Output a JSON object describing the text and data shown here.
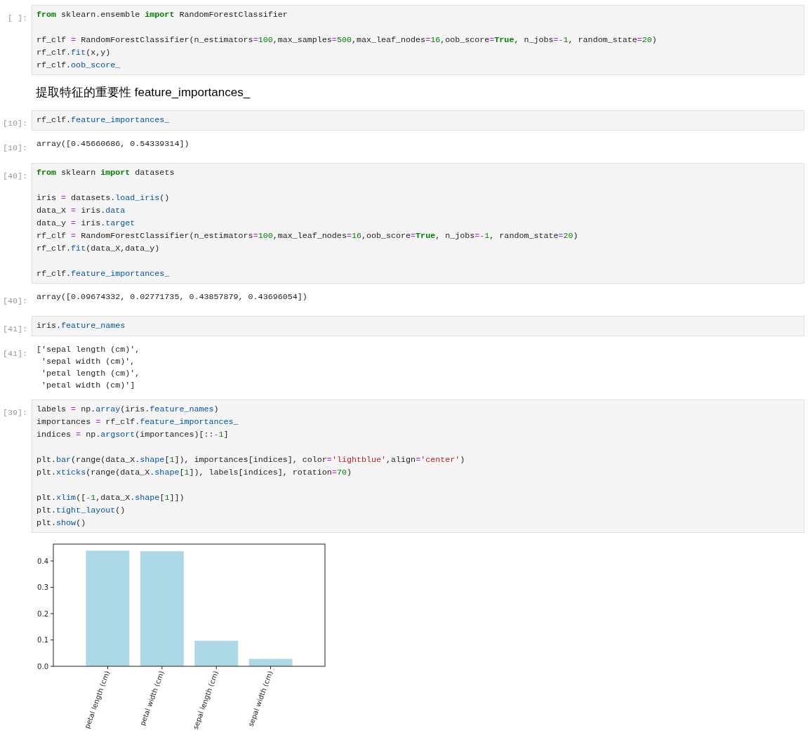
{
  "cells": [
    {
      "kind": "code",
      "prompt": "[ ]:",
      "blocks": [
        [
          [
            {
              "kind": "kw",
              "t": "from"
            },
            {
              "kind": "p",
              "t": " sklearn.ensemble "
            },
            {
              "kind": "kw",
              "t": "import"
            },
            {
              "kind": "p",
              "t": " RandomForestClassifier"
            }
          ]
        ],
        [
          [
            {
              "kind": "p",
              "t": "rf_clf "
            },
            {
              "kind": "o",
              "t": "="
            },
            {
              "kind": "p",
              "t": " RandomForestClassifier(n_estimators"
            },
            {
              "kind": "o",
              "t": "="
            },
            {
              "kind": "n",
              "t": "100"
            },
            {
              "kind": "p",
              "t": ",max_samples"
            },
            {
              "kind": "o",
              "t": "="
            },
            {
              "kind": "n",
              "t": "500"
            },
            {
              "kind": "p",
              "t": ",max_leaf_nodes"
            },
            {
              "kind": "o",
              "t": "="
            },
            {
              "kind": "n",
              "t": "16"
            },
            {
              "kind": "p",
              "t": ",oob_score"
            },
            {
              "kind": "o",
              "t": "="
            },
            {
              "kind": "kw",
              "t": "True"
            },
            {
              "kind": "p",
              "t": ", n_jobs"
            },
            {
              "kind": "o",
              "t": "=-"
            },
            {
              "kind": "n",
              "t": "1"
            },
            {
              "kind": "p",
              "t": ", random_state"
            },
            {
              "kind": "o",
              "t": "="
            },
            {
              "kind": "n",
              "t": "20"
            },
            {
              "kind": "p",
              "t": ")"
            }
          ],
          [
            {
              "kind": "p",
              "t": "rf_clf."
            },
            {
              "kind": "a",
              "t": "fit"
            },
            {
              "kind": "p",
              "t": "(x,y)"
            }
          ],
          [
            {
              "kind": "p",
              "t": "rf_clf."
            },
            {
              "kind": "a",
              "t": "oob_score_"
            }
          ]
        ]
      ]
    },
    {
      "kind": "markdown",
      "text": "提取特征的重要性 feature_importances_"
    },
    {
      "kind": "code",
      "prompt": "[10]:",
      "blocks": [
        [
          [
            {
              "kind": "p",
              "t": "rf_clf."
            },
            {
              "kind": "a",
              "t": "feature_importances_"
            }
          ]
        ]
      ]
    },
    {
      "kind": "output",
      "prompt": "[10]:",
      "lines": [
        "array([0.45660686, 0.54339314])"
      ]
    },
    {
      "kind": "code",
      "prompt": "[40]:",
      "blocks": [
        [
          [
            {
              "kind": "kw",
              "t": "from"
            },
            {
              "kind": "p",
              "t": " sklearn "
            },
            {
              "kind": "kw",
              "t": "import"
            },
            {
              "kind": "p",
              "t": " datasets"
            }
          ]
        ],
        [
          [
            {
              "kind": "p",
              "t": "iris "
            },
            {
              "kind": "o",
              "t": "="
            },
            {
              "kind": "p",
              "t": " datasets."
            },
            {
              "kind": "a",
              "t": "load_iris"
            },
            {
              "kind": "p",
              "t": "()"
            }
          ],
          [
            {
              "kind": "p",
              "t": "data_X "
            },
            {
              "kind": "o",
              "t": "="
            },
            {
              "kind": "p",
              "t": " iris."
            },
            {
              "kind": "a",
              "t": "data"
            }
          ],
          [
            {
              "kind": "p",
              "t": "data_y "
            },
            {
              "kind": "o",
              "t": "="
            },
            {
              "kind": "p",
              "t": " iris."
            },
            {
              "kind": "a",
              "t": "target"
            }
          ],
          [
            {
              "kind": "p",
              "t": "rf_clf "
            },
            {
              "kind": "o",
              "t": "="
            },
            {
              "kind": "p",
              "t": " RandomForestClassifier(n_estimators"
            },
            {
              "kind": "o",
              "t": "="
            },
            {
              "kind": "n",
              "t": "100"
            },
            {
              "kind": "p",
              "t": ",max_leaf_nodes"
            },
            {
              "kind": "o",
              "t": "="
            },
            {
              "kind": "n",
              "t": "16"
            },
            {
              "kind": "p",
              "t": ",oob_score"
            },
            {
              "kind": "o",
              "t": "="
            },
            {
              "kind": "kw",
              "t": "True"
            },
            {
              "kind": "p",
              "t": ", n_jobs"
            },
            {
              "kind": "o",
              "t": "=-"
            },
            {
              "kind": "n",
              "t": "1"
            },
            {
              "kind": "p",
              "t": ", random_state"
            },
            {
              "kind": "o",
              "t": "="
            },
            {
              "kind": "n",
              "t": "20"
            },
            {
              "kind": "p",
              "t": ")"
            }
          ],
          [
            {
              "kind": "p",
              "t": "rf_clf."
            },
            {
              "kind": "a",
              "t": "fit"
            },
            {
              "kind": "p",
              "t": "(data_X,data_y)"
            }
          ]
        ],
        [
          [
            {
              "kind": "p",
              "t": "rf_clf."
            },
            {
              "kind": "a",
              "t": "feature_importances_"
            }
          ]
        ]
      ]
    },
    {
      "kind": "output",
      "prompt": "[40]:",
      "lines": [
        "array([0.09674332, 0.02771735, 0.43857879, 0.43696054])"
      ]
    },
    {
      "kind": "code",
      "prompt": "[41]:",
      "blocks": [
        [
          [
            {
              "kind": "p",
              "t": "iris."
            },
            {
              "kind": "a",
              "t": "feature_names"
            }
          ]
        ]
      ]
    },
    {
      "kind": "output",
      "prompt": "[41]:",
      "lines": [
        "['sepal length (cm)',",
        " 'sepal width (cm)',",
        " 'petal length (cm)',",
        " 'petal width (cm)']"
      ]
    },
    {
      "kind": "code",
      "prompt": "[39]:",
      "blocks": [
        [
          [
            {
              "kind": "p",
              "t": "labels "
            },
            {
              "kind": "o",
              "t": "="
            },
            {
              "kind": "p",
              "t": " np."
            },
            {
              "kind": "a",
              "t": "array"
            },
            {
              "kind": "p",
              "t": "(iris."
            },
            {
              "kind": "a",
              "t": "feature_names"
            },
            {
              "kind": "p",
              "t": ")"
            }
          ],
          [
            {
              "kind": "p",
              "t": "importances "
            },
            {
              "kind": "o",
              "t": "="
            },
            {
              "kind": "p",
              "t": " rf_clf."
            },
            {
              "kind": "a",
              "t": "feature_importances_"
            }
          ],
          [
            {
              "kind": "p",
              "t": "indices "
            },
            {
              "kind": "o",
              "t": "="
            },
            {
              "kind": "p",
              "t": " np."
            },
            {
              "kind": "a",
              "t": "argsort"
            },
            {
              "kind": "p",
              "t": "(importances)[::"
            },
            {
              "kind": "o",
              "t": "-"
            },
            {
              "kind": "n",
              "t": "1"
            },
            {
              "kind": "p",
              "t": "]"
            }
          ]
        ],
        [
          [
            {
              "kind": "p",
              "t": "plt."
            },
            {
              "kind": "a",
              "t": "bar"
            },
            {
              "kind": "p",
              "t": "(range(data_X."
            },
            {
              "kind": "a",
              "t": "shape"
            },
            {
              "kind": "p",
              "t": "["
            },
            {
              "kind": "n",
              "t": "1"
            },
            {
              "kind": "p",
              "t": "]), importances[indices], color"
            },
            {
              "kind": "o",
              "t": "="
            },
            {
              "kind": "s",
              "t": "'lightblue'"
            },
            {
              "kind": "p",
              "t": ",align"
            },
            {
              "kind": "o",
              "t": "="
            },
            {
              "kind": "s",
              "t": "'center'"
            },
            {
              "kind": "p",
              "t": ")"
            }
          ],
          [
            {
              "kind": "p",
              "t": "plt."
            },
            {
              "kind": "a",
              "t": "xticks"
            },
            {
              "kind": "p",
              "t": "(range(data_X."
            },
            {
              "kind": "a",
              "t": "shape"
            },
            {
              "kind": "p",
              "t": "["
            },
            {
              "kind": "n",
              "t": "1"
            },
            {
              "kind": "p",
              "t": "]), labels[indices], rotation"
            },
            {
              "kind": "o",
              "t": "="
            },
            {
              "kind": "n",
              "t": "70"
            },
            {
              "kind": "p",
              "t": ")"
            }
          ]
        ],
        [
          [
            {
              "kind": "p",
              "t": "plt."
            },
            {
              "kind": "a",
              "t": "xlim"
            },
            {
              "kind": "p",
              "t": "(["
            },
            {
              "kind": "o",
              "t": "-"
            },
            {
              "kind": "n",
              "t": "1"
            },
            {
              "kind": "p",
              "t": ",data_X."
            },
            {
              "kind": "a",
              "t": "shape"
            },
            {
              "kind": "p",
              "t": "["
            },
            {
              "kind": "n",
              "t": "1"
            },
            {
              "kind": "p",
              "t": "]])"
            }
          ],
          [
            {
              "kind": "p",
              "t": "plt."
            },
            {
              "kind": "a",
              "t": "tight_layout"
            },
            {
              "kind": "p",
              "t": "()"
            }
          ],
          [
            {
              "kind": "p",
              "t": "plt."
            },
            {
              "kind": "a",
              "t": "show"
            },
            {
              "kind": "p",
              "t": "()"
            }
          ]
        ]
      ]
    },
    {
      "kind": "chart",
      "chart_data": {
        "type": "bar",
        "categories": [
          "petal length (cm)",
          "petal width (cm)",
          "sepal length (cm)",
          "sepal width (cm)"
        ],
        "values": [
          0.439,
          0.437,
          0.097,
          0.028
        ],
        "ylim": [
          0,
          0.464
        ],
        "yticks": [
          {
            "value": 0,
            "label": "0.0"
          },
          {
            "value": 0.1,
            "label": "0.1"
          },
          {
            "value": 0.2,
            "label": "0.2"
          },
          {
            "value": 0.3,
            "label": "0.3"
          },
          {
            "value": 0.4,
            "label": "0.4"
          }
        ]
      }
    }
  ]
}
